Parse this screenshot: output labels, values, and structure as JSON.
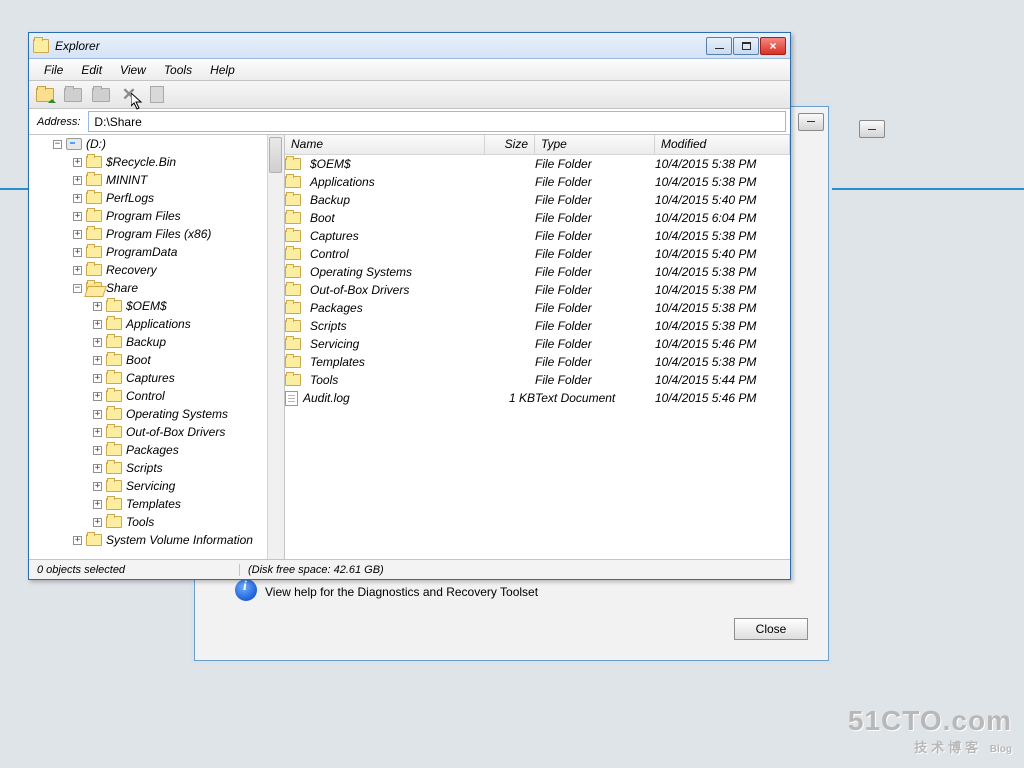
{
  "window": {
    "title": "Explorer",
    "menu": [
      "File",
      "Edit",
      "View",
      "Tools",
      "Help"
    ],
    "address_label": "Address:",
    "address_value": "D:\\Share"
  },
  "tree": {
    "root": "(D:)",
    "level1": [
      "$Recycle.Bin",
      "MININT",
      "PerfLogs",
      "Program Files",
      "Program Files (x86)",
      "ProgramData",
      "Recovery"
    ],
    "share": "Share",
    "share_children": [
      "$OEM$",
      "Applications",
      "Backup",
      "Boot",
      "Captures",
      "Control",
      "Operating Systems",
      "Out-of-Box Drivers",
      "Packages",
      "Scripts",
      "Servicing",
      "Templates",
      "Tools"
    ],
    "tail": "System Volume Information"
  },
  "columns": {
    "name": "Name",
    "size": "Size",
    "type": "Type",
    "modified": "Modified"
  },
  "files": [
    {
      "name": "$OEM$",
      "size": "",
      "type": "File Folder",
      "modified": "10/4/2015 5:38 PM",
      "icon": "folder"
    },
    {
      "name": "Applications",
      "size": "",
      "type": "File Folder",
      "modified": "10/4/2015 5:38 PM",
      "icon": "folder"
    },
    {
      "name": "Backup",
      "size": "",
      "type": "File Folder",
      "modified": "10/4/2015 5:40 PM",
      "icon": "folder"
    },
    {
      "name": "Boot",
      "size": "",
      "type": "File Folder",
      "modified": "10/4/2015 6:04 PM",
      "icon": "folder"
    },
    {
      "name": "Captures",
      "size": "",
      "type": "File Folder",
      "modified": "10/4/2015 5:38 PM",
      "icon": "folder"
    },
    {
      "name": "Control",
      "size": "",
      "type": "File Folder",
      "modified": "10/4/2015 5:40 PM",
      "icon": "folder"
    },
    {
      "name": "Operating Systems",
      "size": "",
      "type": "File Folder",
      "modified": "10/4/2015 5:38 PM",
      "icon": "folder"
    },
    {
      "name": "Out-of-Box Drivers",
      "size": "",
      "type": "File Folder",
      "modified": "10/4/2015 5:38 PM",
      "icon": "folder"
    },
    {
      "name": "Packages",
      "size": "",
      "type": "File Folder",
      "modified": "10/4/2015 5:38 PM",
      "icon": "folder"
    },
    {
      "name": "Scripts",
      "size": "",
      "type": "File Folder",
      "modified": "10/4/2015 5:38 PM",
      "icon": "folder"
    },
    {
      "name": "Servicing",
      "size": "",
      "type": "File Folder",
      "modified": "10/4/2015 5:46 PM",
      "icon": "folder"
    },
    {
      "name": "Templates",
      "size": "",
      "type": "File Folder",
      "modified": "10/4/2015 5:38 PM",
      "icon": "folder"
    },
    {
      "name": "Tools",
      "size": "",
      "type": "File Folder",
      "modified": "10/4/2015 5:44 PM",
      "icon": "folder"
    },
    {
      "name": "Audit.log",
      "size": "1 KB",
      "type": "Text Document",
      "modified": "10/4/2015 5:46 PM",
      "icon": "doc"
    }
  ],
  "status": {
    "selection": "0 objects selected",
    "disk": "(Disk free space: 42.61 GB)"
  },
  "bg_dialog": {
    "help_text": "View help for the Diagnostics and Recovery Toolset",
    "close": "Close"
  },
  "watermark": {
    "top": "51CTO.com",
    "bot_cn": "技术博客",
    "bot_en": "Blog"
  }
}
